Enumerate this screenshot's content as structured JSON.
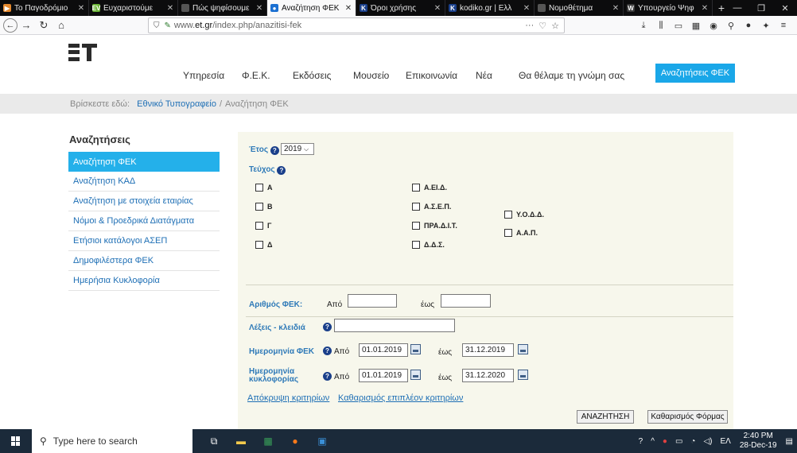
{
  "browser": {
    "tabs": [
      {
        "label": "Το Παγοδρόμιο",
        "color": "#e68a2e",
        "glyph": "▶"
      },
      {
        "label": "Ευχαριστούμε",
        "color": "#6bb536",
        "glyph": "EV"
      },
      {
        "label": "Πώς ψηφίσουμε",
        "color": "#555555",
        "glyph": ""
      },
      {
        "label": "Αναζήτηση ΦΕΚ",
        "color": "#1a6fd1",
        "glyph": "●",
        "active": true
      },
      {
        "label": "Όροι χρήσης",
        "color": "#1a3f8a",
        "glyph": "K"
      },
      {
        "label": "kodiko.gr | Ελλ",
        "color": "#1a3f8a",
        "glyph": "K"
      },
      {
        "label": "Νομοθέτημα",
        "color": "#555555",
        "glyph": ""
      },
      {
        "label": "Υπουργείο Ψηφ",
        "color": "#3a3a3a",
        "glyph": "W"
      }
    ],
    "new_tab": "+",
    "window_controls": [
      "—",
      "❐",
      "✕"
    ],
    "url_prefix": "www.",
    "url_domain": "et.gr",
    "url_path": "/index.php/anazitisi-fek",
    "url_actions": [
      "···",
      "♡",
      "☆"
    ]
  },
  "site": {
    "nav": [
      {
        "label": "Υπηρεσία"
      },
      {
        "label": "Φ.Ε.Κ."
      },
      {
        "label": "Εκδόσεις"
      },
      {
        "label": "Μουσείο"
      },
      {
        "label": "Επικοινωνία"
      },
      {
        "label": "Νέα"
      },
      {
        "label": "Θα θέλαμε τη γνώμη σας"
      }
    ],
    "cta": "Αναζητήσεις ΦΕΚ",
    "breadcrumb": {
      "prefix": "Βρίσκεστε εδώ:",
      "home": "Εθνικό Τυπογραφείο",
      "sep": "/",
      "current": "Αναζήτηση ΦΕΚ"
    },
    "sidebar": {
      "title": "Αναζητήσεις",
      "items": [
        {
          "label": "Αναζήτηση ΦΕΚ",
          "active": true
        },
        {
          "label": "Αναζήτηση ΚΑΔ"
        },
        {
          "label": "Αναζήτηση με στοιχεία εταιρίας"
        },
        {
          "label": "Νόμοι & Προεδρικά Διατάγματα"
        },
        {
          "label": "Ετήσιοι κατάλογοι ΑΣΕΠ"
        },
        {
          "label": "Δημοφιλέστερα ΦΕΚ"
        },
        {
          "label": "Ημερήσια Κυκλοφορία"
        }
      ]
    },
    "form": {
      "year_label": "Έτος",
      "year_value": "2019",
      "issue_label": "Τεύχος",
      "issues_col1": [
        "Α",
        "Β",
        "Γ",
        "Δ"
      ],
      "issues_col2": [
        "Α.ΕΙ.Δ.",
        "Α.Σ.Ε.Π.",
        "ΠΡΑ.Δ.Ι.Τ.",
        "Δ.Δ.Σ."
      ],
      "issues_col3": [
        "Υ.Ο.Δ.Δ.",
        "Α.Α.Π."
      ],
      "number_label": "Αριθμός ΦΕΚ:",
      "from_label": "Από",
      "to_label": "έως",
      "number_from": "",
      "number_to": "",
      "keywords_label": "Λέξεις - κλειδιά",
      "keywords_value": "",
      "date_label": "Ημερομηνία ΦΕΚ",
      "date_from": "01.01.2019",
      "date_to": "31.12.2019",
      "release_label_1": "Ημερομηνία",
      "release_label_2": "κυκλοφορίας",
      "release_from": "01.01.2019",
      "release_to": "31.12.2020",
      "hide_criteria": "Απόκρυψη κριτηρίων",
      "clear_criteria": "Καθαρισμός επιπλέον κριτηρίων",
      "search_button": "ΑΝΑΖΗΤΗΣΗ",
      "reset_button": "Καθαρισμός Φόρμας"
    }
  },
  "taskbar": {
    "search_placeholder": "Type here to search",
    "lang": "ΕΛ",
    "time": "2:40 PM",
    "date": "28-Dec-19"
  }
}
